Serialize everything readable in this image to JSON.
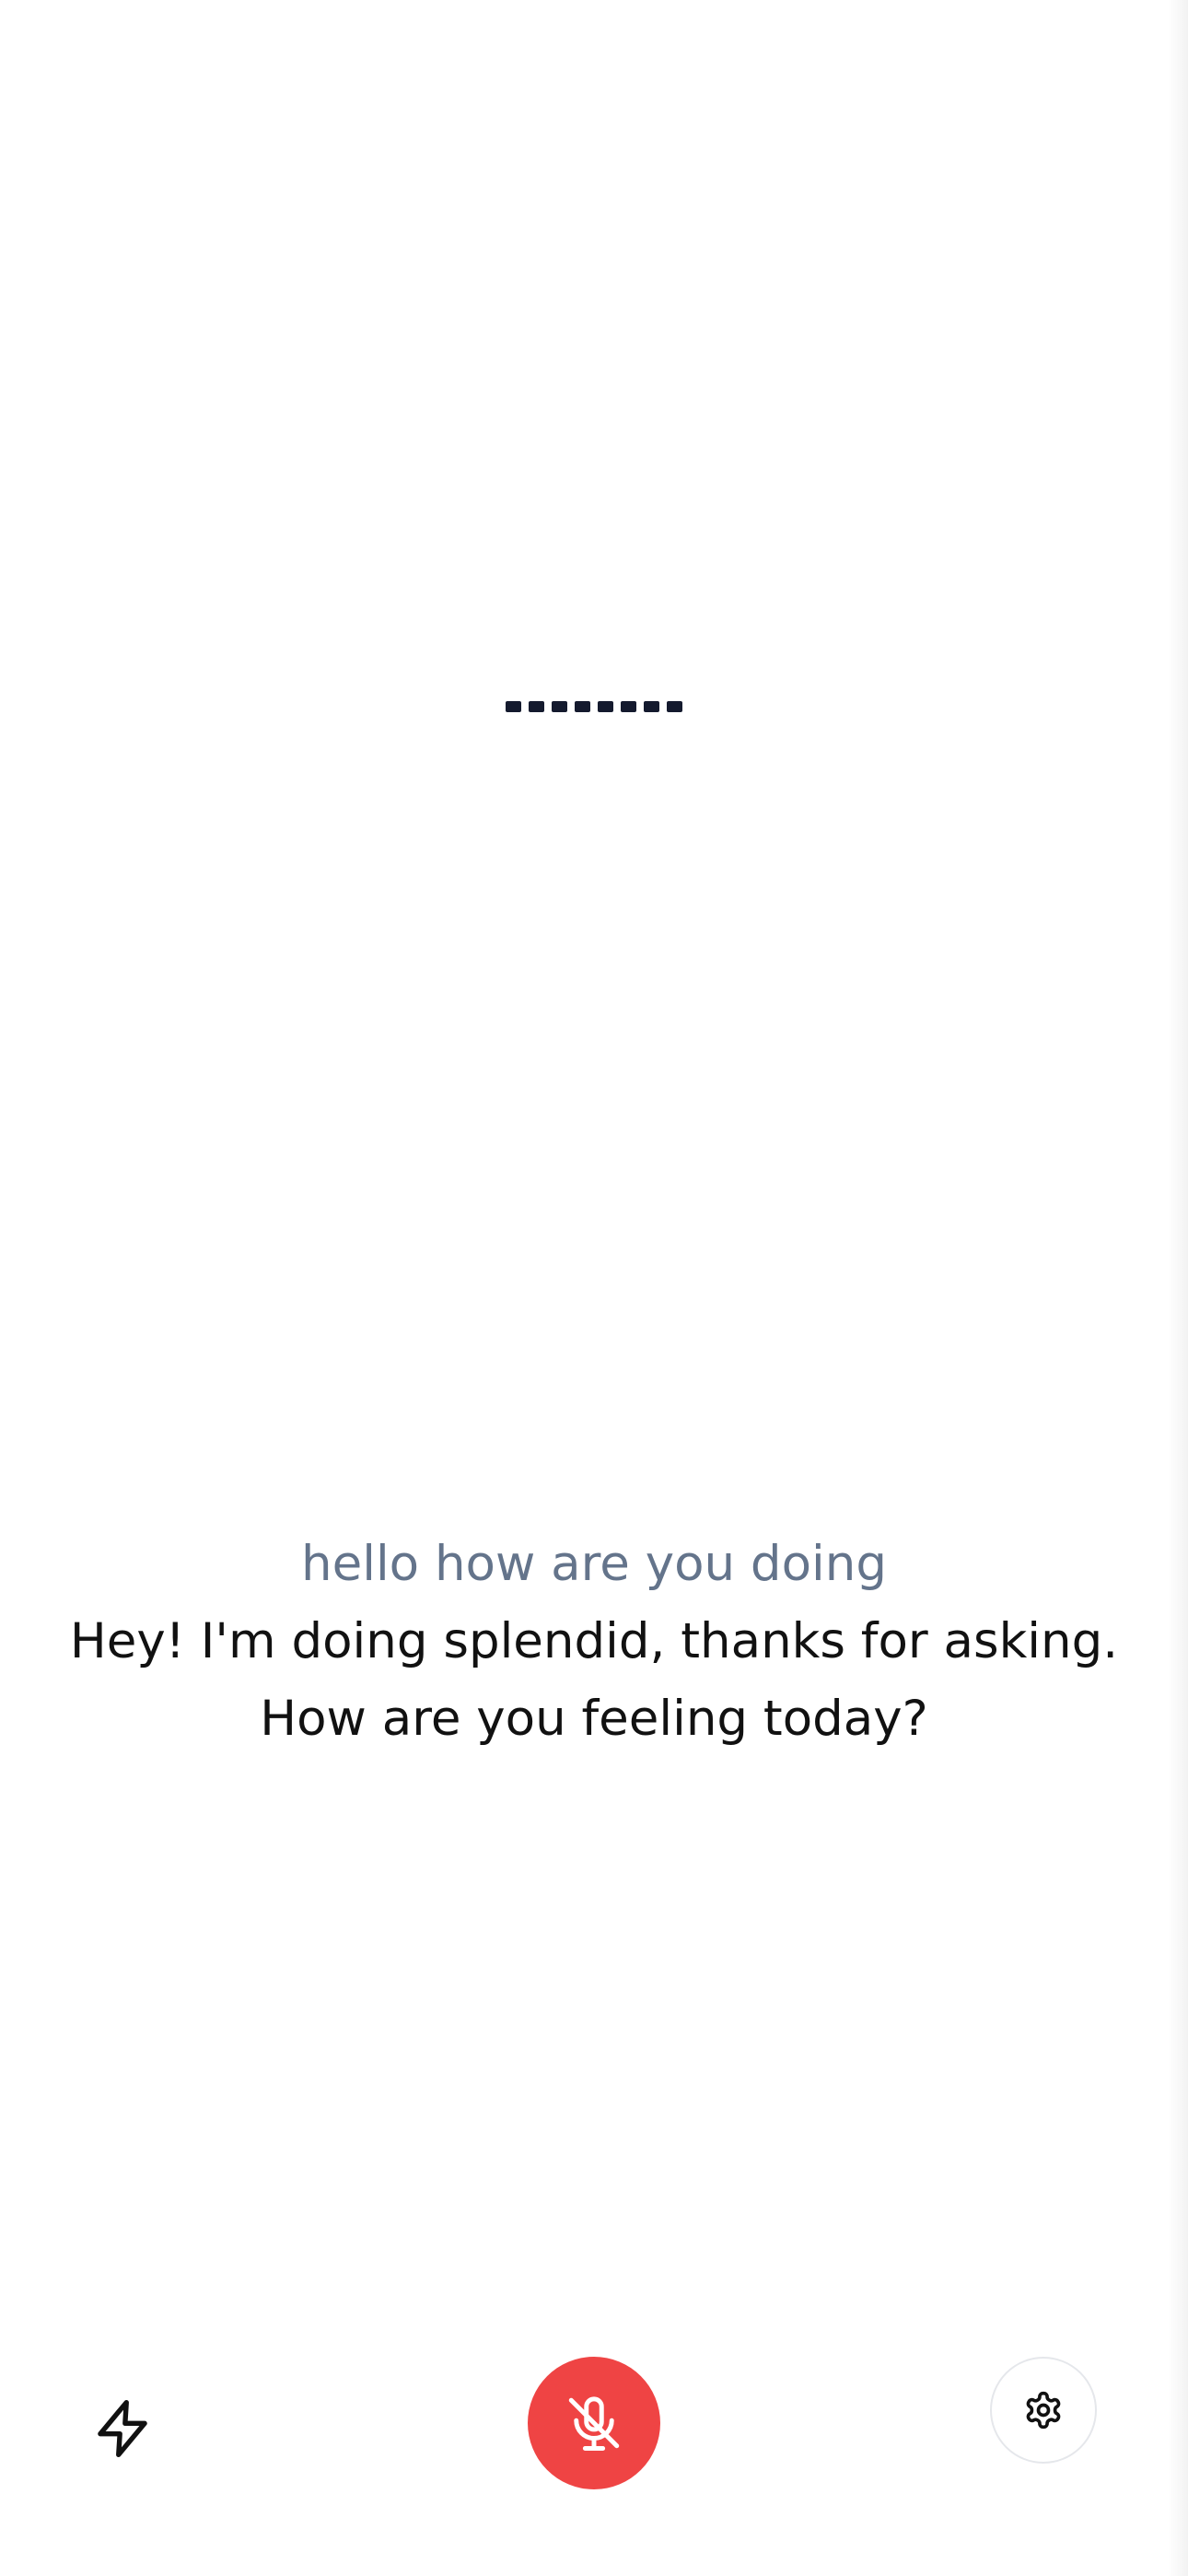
{
  "transcript": {
    "user": "hello how are you doing",
    "assistant": "Hey! I'm doing splendid, thanks for asking. How are you feeling today?"
  },
  "controls": {
    "left_icon": "lightning-icon",
    "center_icon": "microphone-off-icon",
    "right_icon": "gear-icon"
  },
  "colors": {
    "mic_button": "#ef4444",
    "user_text": "#64748b",
    "assistant_text": "#111111",
    "visualizer": "#141a2e"
  }
}
